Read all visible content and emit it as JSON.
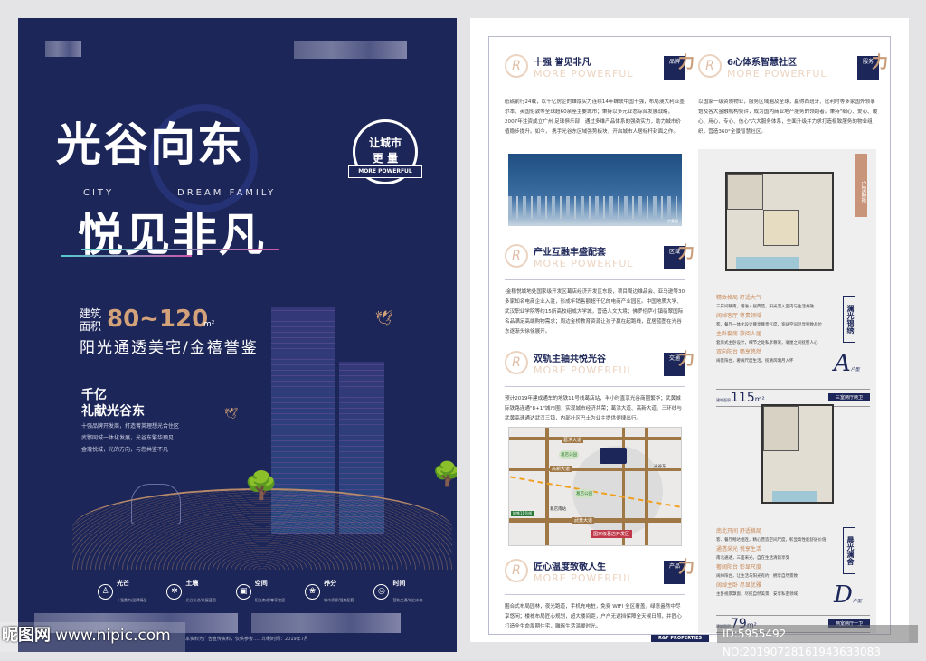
{
  "left": {
    "title1": "光谷向东",
    "title2": "悦见非凡",
    "en1": "CITY",
    "en2": "DREAM FAMILY",
    "seal": {
      "line1": "让城市",
      "line2": "更  量",
      "ribbon": "MORE POWERFUL"
    },
    "area_label1": "建筑",
    "area_label2": "面积",
    "area_value": "80~120",
    "area_unit": "m²",
    "subtitle": "阳光通透美宅/金禧誉鉴",
    "h2_line1": "千亿",
    "h2_line2": "礼献光谷东",
    "bullets": [
      "十强品牌开发商，打造菁英理想光合住区",
      "武鄂同城一体化发展，光谷东繁华预见",
      "金瓏悦城，光的方向，与您共鉴不凡"
    ],
    "features": [
      {
        "icon": "light-icon",
        "title": "光芒",
        "desc": "十强鼎力/品牌精品"
      },
      {
        "icon": "soil-icon",
        "title": "土壤",
        "desc": "光谷东进/发展蓝图"
      },
      {
        "icon": "space-icon",
        "title": "空间",
        "desc": "阳光南北/尊享宜居"
      },
      {
        "icon": "nutrient-icon",
        "title": "养分",
        "desc": "城市资源/强势配套"
      },
      {
        "icon": "time-icon",
        "title": "时间",
        "desc": "营轨交通/诸启未来"
      }
    ],
    "disclaimer": "本资料为广告宣传资料，仅供参考……印刷时间：2019年7月"
  },
  "right": {
    "sections": [
      {
        "title": "十强  誉见非凡",
        "en": "MORE POWERFUL",
        "tag": "品牌",
        "text": "砥砺前行24载，以千亿房企的雄厚实力连续14年蝉联中国十强，布局澳大利亚墨尔本、英国伦敦等全球超60余座主要城市；秉持以多元业态综合发展战略，2007年注资成立广州  足球俱乐部，通过多维产品体系的强劲实力，助力城市价值稳步提升。如今，  携手光谷东区域强势板块，开启城市人居标杆封面之作。"
      },
      {
        "title": "产业互融丰盛配套",
        "en": "MORE POWERFUL",
        "tag": "区域",
        "text": "·金穗悦城地处国家级开发区葛店经济开发区东段，项目周边维品会、亚马逊等30多家知名电商企业入驻，形成年销售额超千亿的电商产业园区。中国地质大学、武汉职业学院等约15所高校组成大学城，营造人文大境；佛罗伦萨小镇翡翠国际名品满足高端购物需求；周边金桥教育资源让孩子赢在起跑线，宜居蓝图在光谷东逐渐头徐徐展开。"
      },
      {
        "title": "双轨主轴共悦光谷",
        "en": "MORE POWERFUL",
        "tag": "交通",
        "text": "预计2019年建成通车的地铁11号线葛店站，半小时直享光谷商圈繁华；武黄城际铁路连通\"8+1\"城市圈，实现城市经济共荣；葛洪大道、高新大道、三环线与武黄高速通达武汉三镇，内部社区巴士为业主提供便捷出行。"
      },
      {
        "title": "匠心温度致敬人生",
        "en": "MORE POWERFUL",
        "tag": "产品",
        "text": "围合式布局园林，夜光跑道，手机充电桩，免费 WIFI 全区覆盖，绿意盎然中尽享悠闲；楼栋布局匠心规划，超大楼间距，户户无遮挡保障全天候日照，并匠心打造全生命周期住宅，雕琢生活温暖时光。"
      },
      {
        "title": "6心体系智慧社区",
        "en": "MORE POWERFUL",
        "tag": "服务",
        "text": "以国家一级资质物业，服务区域遍及全球，赢得西班牙、比利时等多家国外领事馆及各大金融机构赞许，成为国内商业地产服务的领跑者。秉持\"细心、爱心、暖心、用心、专心、信心\"六大服务体系，全面升级并力求打造极致服务的物业组织，营造360°全景智慧社区。"
      }
    ],
    "skyline_caption": "实景图",
    "map_labels": {
      "road1": "葛洪大道",
      "road2": "高新大道",
      "road3": "武黄大道",
      "road4": "光谷东",
      "zone": "国家级葛店开发区",
      "park1": "葛店公园",
      "park2": "葛店公园",
      "station": "葛店南站",
      "metro": "地铁11号线"
    },
    "floorplan_ribbon": "户型解析",
    "plans": [
      {
        "name": "澜光锦绣",
        "letter": "A",
        "letter_sub": "户型",
        "size": "115",
        "unit": "m²",
        "size_label": "建筑面积",
        "rooms": "三室两厅两卫",
        "features": [
          {
            "t": "精致格局  舒适大气",
            "d": "三开间朝南，增进人居典范，阳光漫入室内与生活共融"
          },
          {
            "t": "阔绰客厅  尊贵领域",
            "d": "客、餐厅一体化设计尊享尊贵气度，宽阔空间尽显别致品位"
          },
          {
            "t": "主卧套房  旅阅人居",
            "d": "套房式主卧设计，细节之处私享尊荣，毫厘之间抚慰人心"
          },
          {
            "t": "双向阳台  畅享悠然",
            "d": "阔景阳台，奢阔尺度生活，揽清风明月入怀"
          }
        ]
      },
      {
        "name": "晨光澜舍",
        "letter": "D",
        "letter_sub": "户型",
        "size": "79",
        "unit": "m²",
        "size_label": "建筑面积",
        "rooms": "两室两厅一卫",
        "features": [
          {
            "t": "南北开间  舒适格局",
            "d": "客、餐厅畅达相连，精心营造空间尺度，彰显高性能舒居价值"
          },
          {
            "t": "通透采光  悦享生活",
            "d": "南北通透，三面采光，自在生活清新享受"
          },
          {
            "t": "奢阔阳台  彰显尺度",
            "d": "阔绰阳台，让生活与阳光有约，拥享自然景致"
          },
          {
            "t": "阔绰主卧  尽显优雅",
            "d": "主卧视景飘窗，尽揽自然美景，安享私密领域"
          }
        ]
      }
    ],
    "brand_footer": "R&F PROPERTIES"
  },
  "watermark": {
    "site_cn": "昵图网",
    "site": "www.nipic.com",
    "id": "ID:5955492 NO:20190728161943633083"
  },
  "colors": {
    "navy": "#1d2658",
    "gold": "#d3a27a"
  }
}
